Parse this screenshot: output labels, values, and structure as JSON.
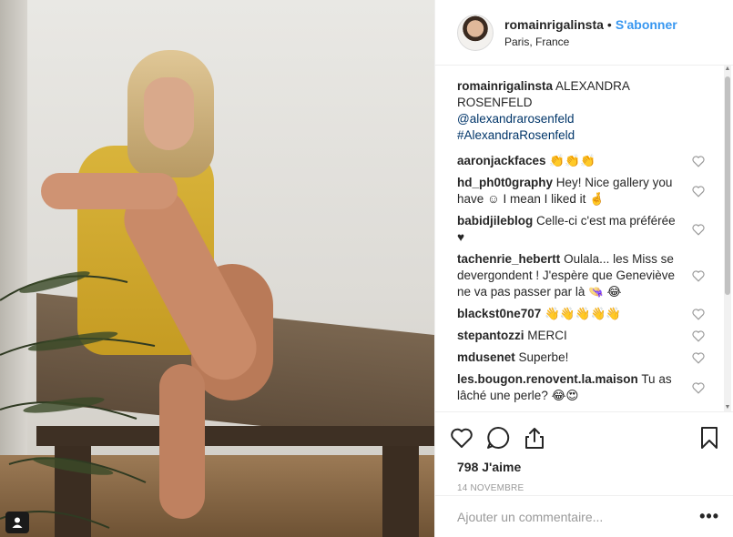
{
  "header": {
    "username": "romainrigalinsta",
    "separator": "•",
    "follow_label": "S'abonner",
    "location": "Paris, France"
  },
  "caption": {
    "username": "romainrigalinsta",
    "text": "ALEXANDRA ROSENFELD",
    "mention": "@alexandrarosenfeld",
    "hashtag": "#AlexandraRosenfeld"
  },
  "comments": [
    {
      "user": "aaronjackfaces",
      "text": "👏👏👏"
    },
    {
      "user": "hd_ph0t0graphy",
      "text": "Hey! Nice gallery you have ☺ I mean I liked it 🤞"
    },
    {
      "user": "babidjileblog",
      "text": "Celle-ci c'est ma préférée ♥"
    },
    {
      "user": "tachenrie_hebertt",
      "text": "Oulala... les Miss se devergondent ! J'espère que Geneviève ne va pas passer par là 👒 😂"
    },
    {
      "user": "blackst0ne707",
      "text": "👋👋👋👋👋"
    },
    {
      "user": "stepantozzi",
      "text": "MERCI"
    },
    {
      "user": "mdusenet",
      "text": "Superbe!"
    },
    {
      "user": "les.bougon.renovent.la.maison",
      "text": "Tu as lâché une perle? 😂😍"
    }
  ],
  "likes": "798 J'aime",
  "date": "14 NOVEMBRE",
  "add_comment": {
    "placeholder": "Ajouter un commentaire..."
  },
  "more_label": "•••",
  "icons": {
    "like": "heart-icon",
    "comment": "comment-icon",
    "share": "share-icon",
    "save": "bookmark-icon",
    "tagged_user": "user-tag-icon"
  }
}
